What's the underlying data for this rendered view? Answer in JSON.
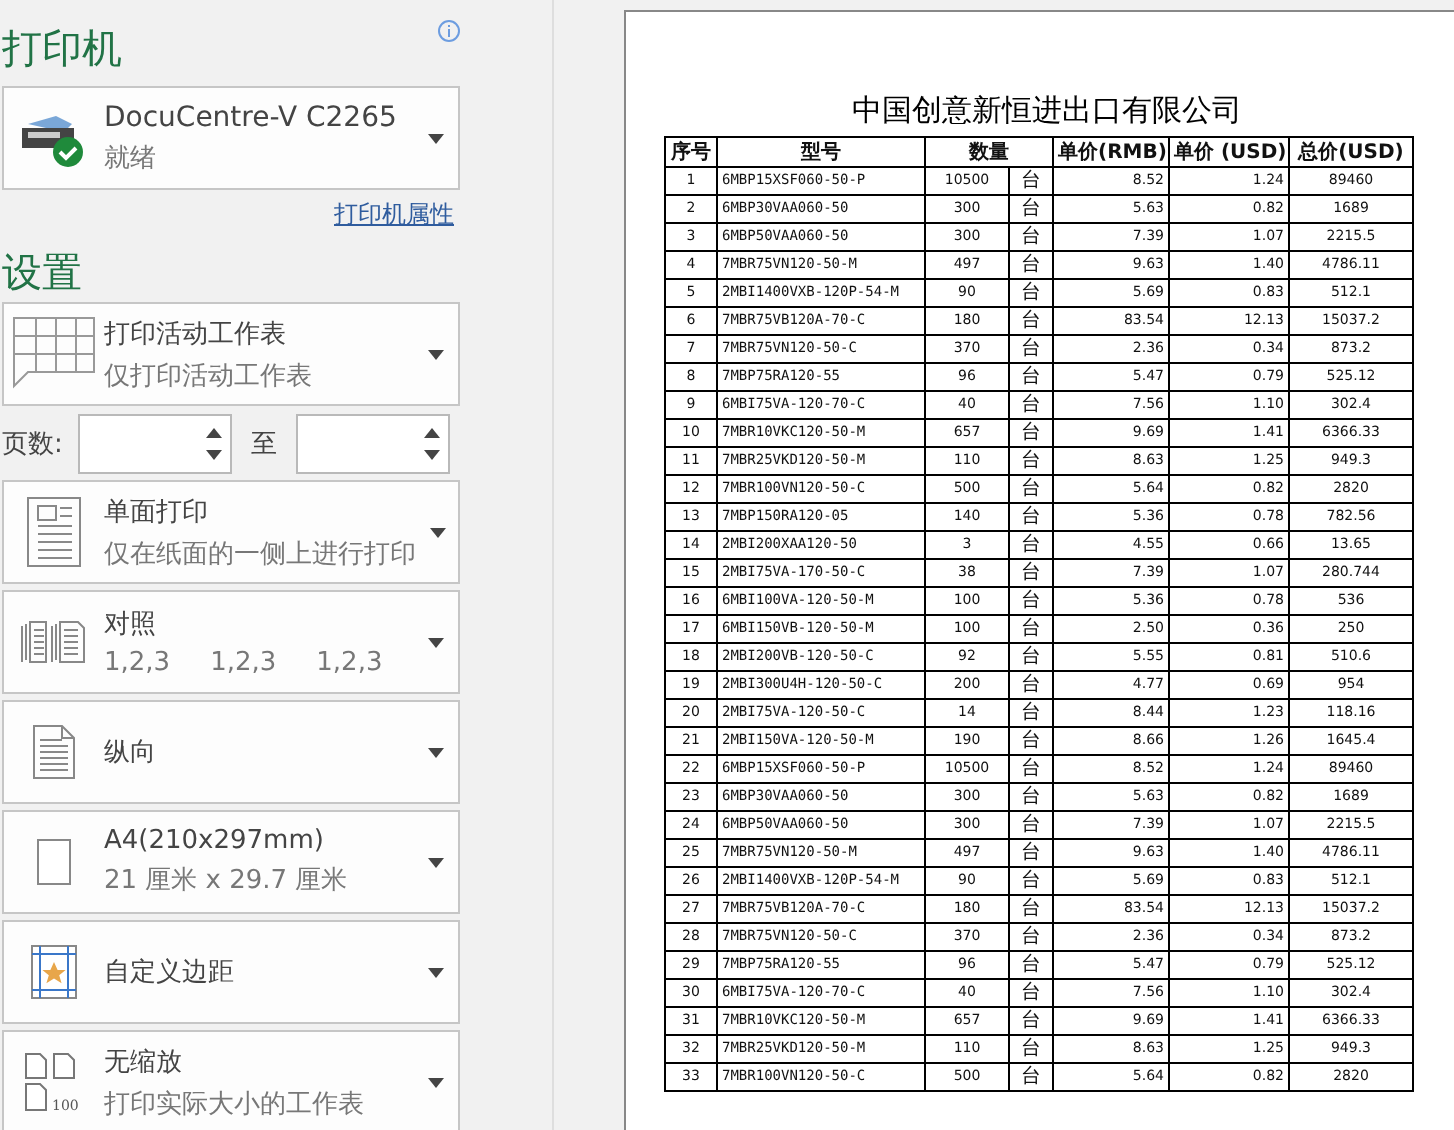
{
  "printer_section": {
    "title": "打印机",
    "printer": {
      "name": "DocuCentre-V C2265",
      "status": "就绪"
    },
    "properties_link": "打印机属性"
  },
  "settings_section": {
    "title": "设置",
    "items": [
      {
        "kind": "dropdown",
        "title": "打印活动工作表",
        "subtitle": "仅打印活动工作表"
      },
      {
        "kind": "page_range",
        "label": "页数:",
        "separator": "至"
      },
      {
        "kind": "dropdown",
        "title": "单面打印",
        "subtitle": "仅在纸面的一侧上进行打印"
      },
      {
        "kind": "collate",
        "title": "对照",
        "subtitle_parts": [
          "1,2,3",
          "1,2,3",
          "1,2,3"
        ]
      },
      {
        "kind": "dropdown",
        "title": "纵向"
      },
      {
        "kind": "dropdown",
        "title": "A4(210x297mm)",
        "subtitle": "21 厘米 x 29.7 厘米"
      },
      {
        "kind": "dropdown",
        "title": "自定义边距"
      },
      {
        "kind": "dropdown",
        "title": "无缩放",
        "subtitle": "打印实际大小的工作表",
        "icon_text": "100"
      }
    ]
  },
  "preview": {
    "title": "中国创意新恒进出口有限公司",
    "table": {
      "columns": [
        {
          "label": "序号"
        },
        {
          "label": "型号"
        },
        {
          "label": "数量",
          "colspan": 2
        },
        {
          "label": "单价(RMB)"
        },
        {
          "label": "单价 (USD)"
        },
        {
          "label": "总价(USD)"
        }
      ],
      "rows": [
        [
          "1",
          "6MBP15XSF060-50-P",
          "10500",
          "台",
          "8.52",
          "1.24",
          "89460"
        ],
        [
          "2",
          "6MBP30VAA060-50",
          "300",
          "台",
          "5.63",
          "0.82",
          "1689"
        ],
        [
          "3",
          "6MBP50VAA060-50",
          "300",
          "台",
          "7.39",
          "1.07",
          "2215.5"
        ],
        [
          "4",
          "7MBR75VN120-50-M",
          "497",
          "台",
          "9.63",
          "1.40",
          "4786.11"
        ],
        [
          "5",
          "2MBI1400VXB-120P-54-M",
          "90",
          "台",
          "5.69",
          "0.83",
          "512.1"
        ],
        [
          "6",
          "7MBR75VB120A-70-C",
          "180",
          "台",
          "83.54",
          "12.13",
          "15037.2"
        ],
        [
          "7",
          "7MBR75VN120-50-C",
          "370",
          "台",
          "2.36",
          "0.34",
          "873.2"
        ],
        [
          "8",
          "7MBP75RA120-55",
          "96",
          "台",
          "5.47",
          "0.79",
          "525.12"
        ],
        [
          "9",
          "6MBI75VA-120-70-C",
          "40",
          "台",
          "7.56",
          "1.10",
          "302.4"
        ],
        [
          "10",
          "7MBR10VKC120-50-M",
          "657",
          "台",
          "9.69",
          "1.41",
          "6366.33"
        ],
        [
          "11",
          "7MBR25VKD120-50-M",
          "110",
          "台",
          "8.63",
          "1.25",
          "949.3"
        ],
        [
          "12",
          "7MBR100VN120-50-C",
          "500",
          "台",
          "5.64",
          "0.82",
          "2820"
        ],
        [
          "13",
          "7MBP150RA120-05",
          "140",
          "台",
          "5.36",
          "0.78",
          "782.56"
        ],
        [
          "14",
          "2MBI200XAA120-50",
          "3",
          "台",
          "4.55",
          "0.66",
          "13.65"
        ],
        [
          "15",
          "2MBI75VA-170-50-C",
          "38",
          "台",
          "7.39",
          "1.07",
          "280.744"
        ],
        [
          "16",
          "6MBI100VA-120-50-M",
          "100",
          "台",
          "5.36",
          "0.78",
          "536"
        ],
        [
          "17",
          "6MBI150VB-120-50-M",
          "100",
          "台",
          "2.50",
          "0.36",
          "250"
        ],
        [
          "18",
          "2MBI200VB-120-50-C",
          "92",
          "台",
          "5.55",
          "0.81",
          "510.6"
        ],
        [
          "19",
          "2MBI300U4H-120-50-C",
          "200",
          "台",
          "4.77",
          "0.69",
          "954"
        ],
        [
          "20",
          "2MBI75VA-120-50-C",
          "14",
          "台",
          "8.44",
          "1.23",
          "118.16"
        ],
        [
          "21",
          "2MBI150VA-120-50-M",
          "190",
          "台",
          "8.66",
          "1.26",
          "1645.4"
        ],
        [
          "22",
          "6MBP15XSF060-50-P",
          "10500",
          "台",
          "8.52",
          "1.24",
          "89460"
        ],
        [
          "23",
          "6MBP30VAA060-50",
          "300",
          "台",
          "5.63",
          "0.82",
          "1689"
        ],
        [
          "24",
          "6MBP50VAA060-50",
          "300",
          "台",
          "7.39",
          "1.07",
          "2215.5"
        ],
        [
          "25",
          "7MBR75VN120-50-M",
          "497",
          "台",
          "9.63",
          "1.40",
          "4786.11"
        ],
        [
          "26",
          "2MBI1400VXB-120P-54-M",
          "90",
          "台",
          "5.69",
          "0.83",
          "512.1"
        ],
        [
          "27",
          "7MBR75VB120A-70-C",
          "180",
          "台",
          "83.54",
          "12.13",
          "15037.2"
        ],
        [
          "28",
          "7MBR75VN120-50-C",
          "370",
          "台",
          "2.36",
          "0.34",
          "873.2"
        ],
        [
          "29",
          "7MBP75RA120-55",
          "96",
          "台",
          "5.47",
          "0.79",
          "525.12"
        ],
        [
          "30",
          "6MBI75VA-120-70-C",
          "40",
          "台",
          "7.56",
          "1.10",
          "302.4"
        ],
        [
          "31",
          "7MBR10VKC120-50-M",
          "657",
          "台",
          "9.69",
          "1.41",
          "6366.33"
        ],
        [
          "32",
          "7MBR25VKD120-50-M",
          "110",
          "台",
          "8.63",
          "1.25",
          "949.3"
        ],
        [
          "33",
          "7MBR100VN120-50-C",
          "500",
          "台",
          "5.64",
          "0.82",
          "2820"
        ]
      ]
    }
  }
}
